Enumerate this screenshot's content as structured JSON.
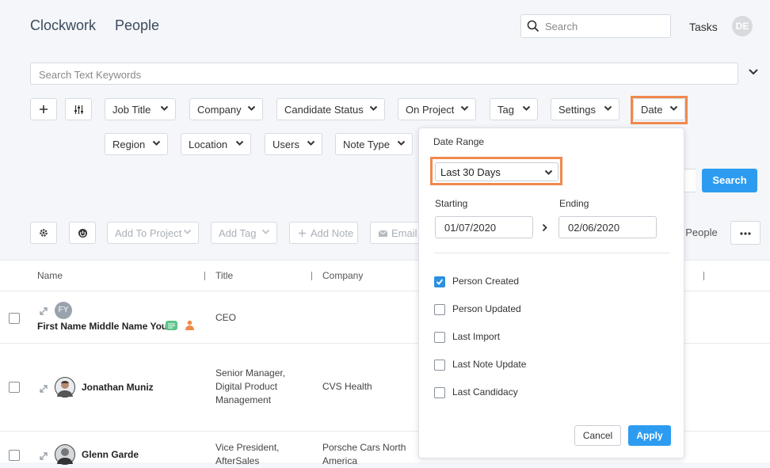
{
  "header": {
    "brand": "Clockwork",
    "section": "People",
    "search_placeholder": "Search",
    "tasks_label": "Tasks",
    "user_initials": "DE"
  },
  "keywords": {
    "placeholder": "Search Text Keywords"
  },
  "filters": {
    "row1": [
      "Job Title",
      "Company",
      "Candidate Status",
      "On Project",
      "Tag",
      "Settings",
      "Date"
    ],
    "row2": [
      "Region",
      "Location",
      "Users",
      "Note Type"
    ]
  },
  "search_button": "Search",
  "actions": {
    "add_to_project": "Add To Project",
    "add_tag": "Add Tag",
    "add_note": "Add Note",
    "email": "Email",
    "people_count": "/ People"
  },
  "date_popover": {
    "title": "Date Range",
    "range_value": "Last 30 Days",
    "starting_label": "Starting",
    "ending_label": "Ending",
    "starting_value": "01/07/2020",
    "ending_value": "02/06/2020",
    "options": [
      {
        "label": "Person Created",
        "checked": true
      },
      {
        "label": "Person Updated",
        "checked": false
      },
      {
        "label": "Last Import",
        "checked": false
      },
      {
        "label": "Last Note Update",
        "checked": false
      },
      {
        "label": "Last Candidacy",
        "checked": false
      }
    ],
    "cancel": "Cancel",
    "apply": "Apply"
  },
  "table": {
    "columns": [
      "Name",
      "Title",
      "Company"
    ],
    "rows": [
      {
        "initials": "FY",
        "name": "First Name Middle Name You",
        "title": [
          "CEO"
        ],
        "company": []
      },
      {
        "initials": "",
        "name": "Jonathan Muniz",
        "title": [
          "Senior Manager,",
          "Digital Product",
          "Management"
        ],
        "company": [
          "CVS Health"
        ]
      },
      {
        "initials": "",
        "name": "Glenn Garde",
        "title": [
          "Vice President,",
          "AfterSales"
        ],
        "company": [
          "Porsche Cars North",
          "America"
        ]
      }
    ]
  },
  "colors": {
    "accent": "#2d9cf0",
    "highlight": "#f0894d"
  }
}
